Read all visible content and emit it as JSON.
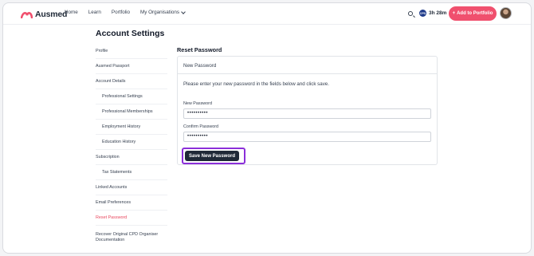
{
  "header": {
    "logo_text": "Ausmed",
    "nav": [
      "Home",
      "Learn",
      "Portfolio"
    ],
    "nav_dropdown": "My Organisations",
    "cpd_time": "3h 28m",
    "add_button": "Add to Portfolio",
    "add_icon": "+"
  },
  "page_title": "Account Settings",
  "sidebar": {
    "items": [
      {
        "label": "Profile"
      },
      {
        "label": "Ausmed Passport"
      },
      {
        "label": "Account Details"
      },
      {
        "label": "Professional Settings"
      },
      {
        "label": "Professional Memberships"
      },
      {
        "label": "Employment History"
      },
      {
        "label": "Education History"
      },
      {
        "label": "Subscription"
      },
      {
        "label": "Tax Statements"
      },
      {
        "label": "Linked Accounts"
      },
      {
        "label": "Email Preferences"
      },
      {
        "label": "Reset Password"
      },
      {
        "label": "Recover Original CPD Organiser Documentation"
      }
    ],
    "active": "Reset Password"
  },
  "section_title": "Reset Password",
  "card": {
    "heading": "New Password",
    "description": "Please enter your new password in the fields below and click save.",
    "new_label": "New Password",
    "new_value": "••••••••••",
    "confirm_label": "Confirm Password",
    "confirm_value": "••••••••••",
    "save_button": "Save New Password"
  },
  "colors": {
    "accent": "#f0506e",
    "active_link": "#e8495f",
    "highlight": "#8b2fd9",
    "button_dark": "#1f2937"
  }
}
